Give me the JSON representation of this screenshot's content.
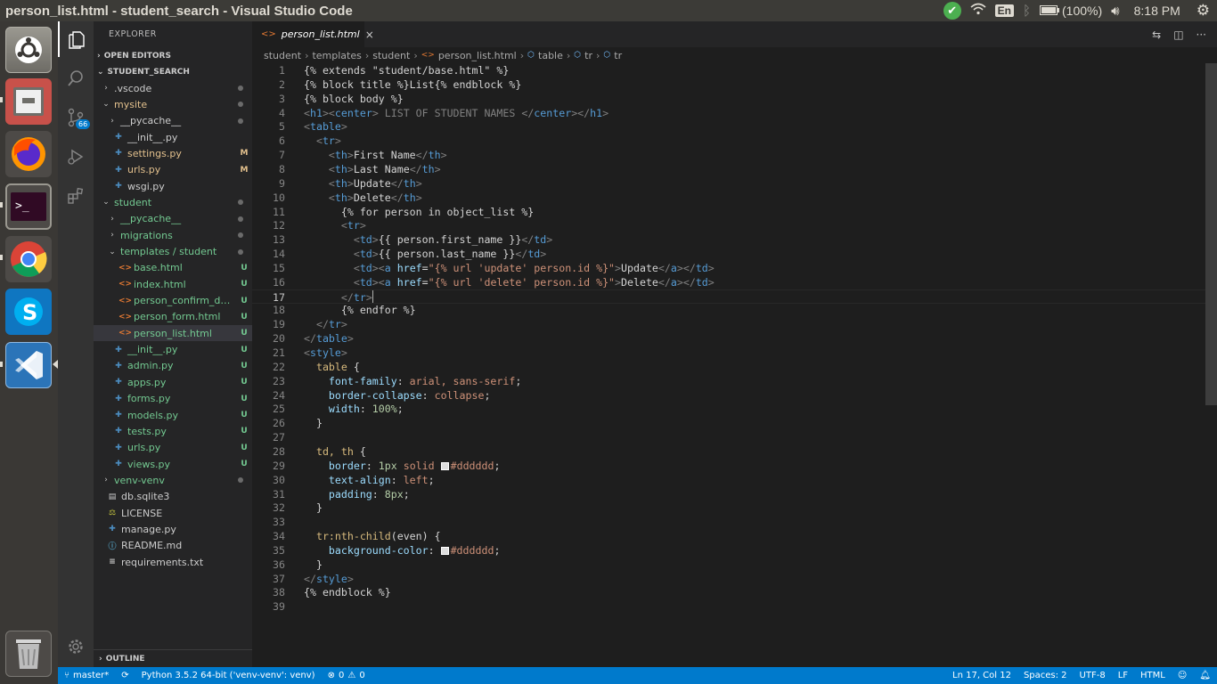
{
  "window_title": "person_list.html - student_search - Visual Studio Code",
  "tray": {
    "language": "En",
    "battery": "(100%)",
    "clock": "8:18 PM"
  },
  "launcher": [
    "ubuntu-dash",
    "files",
    "firefox",
    "terminal",
    "chrome",
    "skype",
    "vscode",
    "trash"
  ],
  "activity": {
    "scm_badge": "66"
  },
  "explorer": {
    "title": "EXPLORER",
    "open_editors": "OPEN EDITORS",
    "workspace": "STUDENT_SEARCH",
    "outline": "OUTLINE",
    "tree": [
      {
        "label": ".vscode",
        "type": "folder",
        "state": "closed",
        "depth": 1,
        "deco": "dot",
        "color": "#cccccc"
      },
      {
        "label": "mysite",
        "type": "folder",
        "state": "open",
        "depth": 1,
        "deco": "dot",
        "color": "#e2c08d"
      },
      {
        "label": "__pycache__",
        "type": "folder",
        "state": "closed",
        "depth": 2,
        "deco": "dot",
        "color": "#cccccc"
      },
      {
        "label": "__init__.py",
        "type": "py",
        "depth": 2,
        "deco": "",
        "color": "#cccccc"
      },
      {
        "label": "settings.py",
        "type": "py",
        "depth": 2,
        "deco": "M",
        "color": "#e2c08d"
      },
      {
        "label": "urls.py",
        "type": "py",
        "depth": 2,
        "deco": "M",
        "color": "#e2c08d"
      },
      {
        "label": "wsgi.py",
        "type": "py",
        "depth": 2,
        "deco": "",
        "color": "#cccccc"
      },
      {
        "label": "student",
        "type": "folder",
        "state": "open",
        "depth": 1,
        "deco": "dot",
        "color": "#73c991"
      },
      {
        "label": "__pycache__",
        "type": "folder",
        "state": "closed",
        "depth": 2,
        "deco": "dot",
        "color": "#73c991"
      },
      {
        "label": "migrations",
        "type": "folder",
        "state": "closed",
        "depth": 2,
        "deco": "dot",
        "color": "#73c991"
      },
      {
        "label": "templates / student",
        "type": "folder",
        "state": "open",
        "depth": 2,
        "deco": "dot",
        "color": "#73c991"
      },
      {
        "label": "base.html",
        "type": "html",
        "depth": 3,
        "deco": "U",
        "color": "#73c991"
      },
      {
        "label": "index.html",
        "type": "html",
        "depth": 3,
        "deco": "U",
        "color": "#73c991"
      },
      {
        "label": "person_confirm_del...",
        "type": "html",
        "depth": 3,
        "deco": "U",
        "color": "#73c991"
      },
      {
        "label": "person_form.html",
        "type": "html",
        "depth": 3,
        "deco": "U",
        "color": "#73c991"
      },
      {
        "label": "person_list.html",
        "type": "html",
        "depth": 3,
        "deco": "U",
        "color": "#73c991",
        "selected": true
      },
      {
        "label": "__init__.py",
        "type": "py",
        "depth": 2,
        "deco": "U",
        "color": "#73c991"
      },
      {
        "label": "admin.py",
        "type": "py",
        "depth": 2,
        "deco": "U",
        "color": "#73c991"
      },
      {
        "label": "apps.py",
        "type": "py",
        "depth": 2,
        "deco": "U",
        "color": "#73c991"
      },
      {
        "label": "forms.py",
        "type": "py",
        "depth": 2,
        "deco": "U",
        "color": "#73c991"
      },
      {
        "label": "models.py",
        "type": "py",
        "depth": 2,
        "deco": "U",
        "color": "#73c991"
      },
      {
        "label": "tests.py",
        "type": "py",
        "depth": 2,
        "deco": "U",
        "color": "#73c991"
      },
      {
        "label": "urls.py",
        "type": "py",
        "depth": 2,
        "deco": "U",
        "color": "#73c991"
      },
      {
        "label": "views.py",
        "type": "py",
        "depth": 2,
        "deco": "U",
        "color": "#73c991"
      },
      {
        "label": "venv-venv",
        "type": "folder",
        "state": "closed",
        "depth": 1,
        "deco": "dot",
        "color": "#73c991"
      },
      {
        "label": "db.sqlite3",
        "type": "db",
        "depth": 1,
        "deco": "",
        "color": "#cccccc"
      },
      {
        "label": "LICENSE",
        "type": "license",
        "depth": 1,
        "deco": "",
        "color": "#cccccc"
      },
      {
        "label": "manage.py",
        "type": "py",
        "depth": 1,
        "deco": "",
        "color": "#cccccc"
      },
      {
        "label": "README.md",
        "type": "info",
        "depth": 1,
        "deco": "",
        "color": "#cccccc"
      },
      {
        "label": "requirements.txt",
        "type": "txt",
        "depth": 1,
        "deco": "",
        "color": "#cccccc"
      }
    ]
  },
  "editor": {
    "tab_label": "person_list.html",
    "breadcrumb": [
      "student",
      "templates",
      "student",
      "person_list.html",
      "table",
      "tr",
      "tr"
    ],
    "current_line": 17,
    "lines": [
      [
        [
          "{% extends \"student/base.html\" %}",
          "tpl"
        ]
      ],
      [
        [
          "{% block title %}List{% endblock %}",
          "tpl"
        ]
      ],
      [
        [
          "{% block body %}",
          "tpl"
        ]
      ],
      [
        [
          "<",
          "br"
        ],
        [
          "h1",
          "tag"
        ],
        [
          "><",
          "br"
        ],
        [
          "center",
          "tag"
        ],
        [
          "> LIST OF STUDENT NAMES </",
          "br"
        ],
        [
          "center",
          "tag"
        ],
        [
          "></",
          "br"
        ],
        [
          "h1",
          "tag"
        ],
        [
          ">",
          "br"
        ]
      ],
      [
        [
          "<",
          "br"
        ],
        [
          "table",
          "tag"
        ],
        [
          ">",
          "br"
        ]
      ],
      [
        [
          "  ",
          "txt"
        ],
        [
          "<",
          "br"
        ],
        [
          "tr",
          "tag"
        ],
        [
          ">",
          "br"
        ]
      ],
      [
        [
          "    ",
          "txt"
        ],
        [
          "<",
          "br"
        ],
        [
          "th",
          "tag"
        ],
        [
          ">",
          "br"
        ],
        [
          "First Name",
          "txt"
        ],
        [
          "</",
          "br"
        ],
        [
          "th",
          "tag"
        ],
        [
          ">",
          "br"
        ]
      ],
      [
        [
          "    ",
          "txt"
        ],
        [
          "<",
          "br"
        ],
        [
          "th",
          "tag"
        ],
        [
          ">",
          "br"
        ],
        [
          "Last Name",
          "txt"
        ],
        [
          "</",
          "br"
        ],
        [
          "th",
          "tag"
        ],
        [
          ">",
          "br"
        ]
      ],
      [
        [
          "    ",
          "txt"
        ],
        [
          "<",
          "br"
        ],
        [
          "th",
          "tag"
        ],
        [
          ">",
          "br"
        ],
        [
          "Update",
          "txt"
        ],
        [
          "</",
          "br"
        ],
        [
          "th",
          "tag"
        ],
        [
          ">",
          "br"
        ]
      ],
      [
        [
          "    ",
          "txt"
        ],
        [
          "<",
          "br"
        ],
        [
          "th",
          "tag"
        ],
        [
          ">",
          "br"
        ],
        [
          "Delete",
          "txt"
        ],
        [
          "</",
          "br"
        ],
        [
          "th",
          "tag"
        ],
        [
          ">",
          "br"
        ]
      ],
      [
        [
          "      {% for person in object_list %}",
          "tpl"
        ]
      ],
      [
        [
          "      ",
          "txt"
        ],
        [
          "<",
          "br"
        ],
        [
          "tr",
          "tag"
        ],
        [
          ">",
          "br"
        ]
      ],
      [
        [
          "        ",
          "txt"
        ],
        [
          "<",
          "br"
        ],
        [
          "td",
          "tag"
        ],
        [
          ">",
          "br"
        ],
        [
          "{{ person.first_name }}",
          "txt"
        ],
        [
          "</",
          "br"
        ],
        [
          "td",
          "tag"
        ],
        [
          ">",
          "br"
        ]
      ],
      [
        [
          "        ",
          "txt"
        ],
        [
          "<",
          "br"
        ],
        [
          "td",
          "tag"
        ],
        [
          ">",
          "br"
        ],
        [
          "{{ person.last_name }}",
          "txt"
        ],
        [
          "</",
          "br"
        ],
        [
          "td",
          "tag"
        ],
        [
          ">",
          "br"
        ]
      ],
      [
        [
          "        ",
          "txt"
        ],
        [
          "<",
          "br"
        ],
        [
          "td",
          "tag"
        ],
        [
          "><",
          "br"
        ],
        [
          "a",
          "tag"
        ],
        [
          " ",
          "txt"
        ],
        [
          "href",
          "attr"
        ],
        [
          "=",
          "txt"
        ],
        [
          "\"{% url 'update' person.id %}\"",
          "str"
        ],
        [
          ">",
          "br"
        ],
        [
          "Update",
          "txt"
        ],
        [
          "</",
          "br"
        ],
        [
          "a",
          "tag"
        ],
        [
          "></",
          "br"
        ],
        [
          "td",
          "tag"
        ],
        [
          ">",
          "br"
        ]
      ],
      [
        [
          "        ",
          "txt"
        ],
        [
          "<",
          "br"
        ],
        [
          "td",
          "tag"
        ],
        [
          "><",
          "br"
        ],
        [
          "a",
          "tag"
        ],
        [
          " ",
          "txt"
        ],
        [
          "href",
          "attr"
        ],
        [
          "=",
          "txt"
        ],
        [
          "\"{% url 'delete' person.id %}\"",
          "str"
        ],
        [
          ">",
          "br"
        ],
        [
          "Delete",
          "txt"
        ],
        [
          "</",
          "br"
        ],
        [
          "a",
          "tag"
        ],
        [
          "></",
          "br"
        ],
        [
          "td",
          "tag"
        ],
        [
          ">",
          "br"
        ]
      ],
      [
        [
          "      ",
          "txt"
        ],
        [
          "</",
          "br"
        ],
        [
          "tr",
          "tag"
        ],
        [
          ">",
          "br"
        ]
      ],
      [
        [
          "      {% endfor %}",
          "tpl"
        ]
      ],
      [
        [
          "  ",
          "txt"
        ],
        [
          "</",
          "br"
        ],
        [
          "tr",
          "tag"
        ],
        [
          ">",
          "br"
        ]
      ],
      [
        [
          "</",
          "br"
        ],
        [
          "table",
          "tag"
        ],
        [
          ">",
          "br"
        ]
      ],
      [
        [
          "<",
          "br"
        ],
        [
          "style",
          "tag"
        ],
        [
          ">",
          "br"
        ]
      ],
      [
        [
          "  ",
          "txt"
        ],
        [
          "table",
          "sel"
        ],
        [
          " {",
          "txt"
        ]
      ],
      [
        [
          "    ",
          "txt"
        ],
        [
          "font-family",
          "prop"
        ],
        [
          ": ",
          "txt"
        ],
        [
          "arial, sans-serif",
          "str"
        ],
        [
          ";",
          "txt"
        ]
      ],
      [
        [
          "    ",
          "txt"
        ],
        [
          "border-collapse",
          "prop"
        ],
        [
          ": ",
          "txt"
        ],
        [
          "collapse",
          "str"
        ],
        [
          ";",
          "txt"
        ]
      ],
      [
        [
          "    ",
          "txt"
        ],
        [
          "width",
          "prop"
        ],
        [
          ": ",
          "txt"
        ],
        [
          "100%",
          "num"
        ],
        [
          ";",
          "txt"
        ]
      ],
      [
        [
          "  }",
          "txt"
        ]
      ],
      [
        [
          "",
          "txt"
        ]
      ],
      [
        [
          "  ",
          "txt"
        ],
        [
          "td, th",
          "sel"
        ],
        [
          " {",
          "txt"
        ]
      ],
      [
        [
          "    ",
          "txt"
        ],
        [
          "border",
          "prop"
        ],
        [
          ": ",
          "txt"
        ],
        [
          "1px",
          "num"
        ],
        [
          " ",
          "txt"
        ],
        [
          "solid",
          "str"
        ],
        [
          " ",
          "txt"
        ],
        [
          "#swatch",
          "swatch"
        ],
        [
          "#dddddd",
          "str"
        ],
        [
          ";",
          "txt"
        ]
      ],
      [
        [
          "    ",
          "txt"
        ],
        [
          "text-align",
          "prop"
        ],
        [
          ": ",
          "txt"
        ],
        [
          "left",
          "str"
        ],
        [
          ";",
          "txt"
        ]
      ],
      [
        [
          "    ",
          "txt"
        ],
        [
          "padding",
          "prop"
        ],
        [
          ": ",
          "txt"
        ],
        [
          "8px",
          "num"
        ],
        [
          ";",
          "txt"
        ]
      ],
      [
        [
          "  }",
          "txt"
        ]
      ],
      [
        [
          "",
          "txt"
        ]
      ],
      [
        [
          "  ",
          "txt"
        ],
        [
          "tr:nth-child",
          "sel"
        ],
        [
          "(even) {",
          "txt"
        ]
      ],
      [
        [
          "    ",
          "txt"
        ],
        [
          "background-color",
          "prop"
        ],
        [
          ": ",
          "txt"
        ],
        [
          "#swatch",
          "swatch"
        ],
        [
          "#dddddd",
          "str"
        ],
        [
          ";",
          "txt"
        ]
      ],
      [
        [
          "  }",
          "txt"
        ]
      ],
      [
        [
          "</",
          "br"
        ],
        [
          "style",
          "tag"
        ],
        [
          ">",
          "br"
        ]
      ],
      [
        [
          "{% endblock %}",
          "tpl"
        ]
      ],
      [
        [
          "",
          "txt"
        ]
      ]
    ]
  },
  "statusbar": {
    "branch": "master*",
    "interpreter": "Python 3.5.2 64-bit ('venv-venv': venv)",
    "errors": "0",
    "warnings": "0",
    "position": "Ln 17, Col 12",
    "spaces": "Spaces: 2",
    "encoding": "UTF-8",
    "eol": "LF",
    "language": "HTML"
  }
}
